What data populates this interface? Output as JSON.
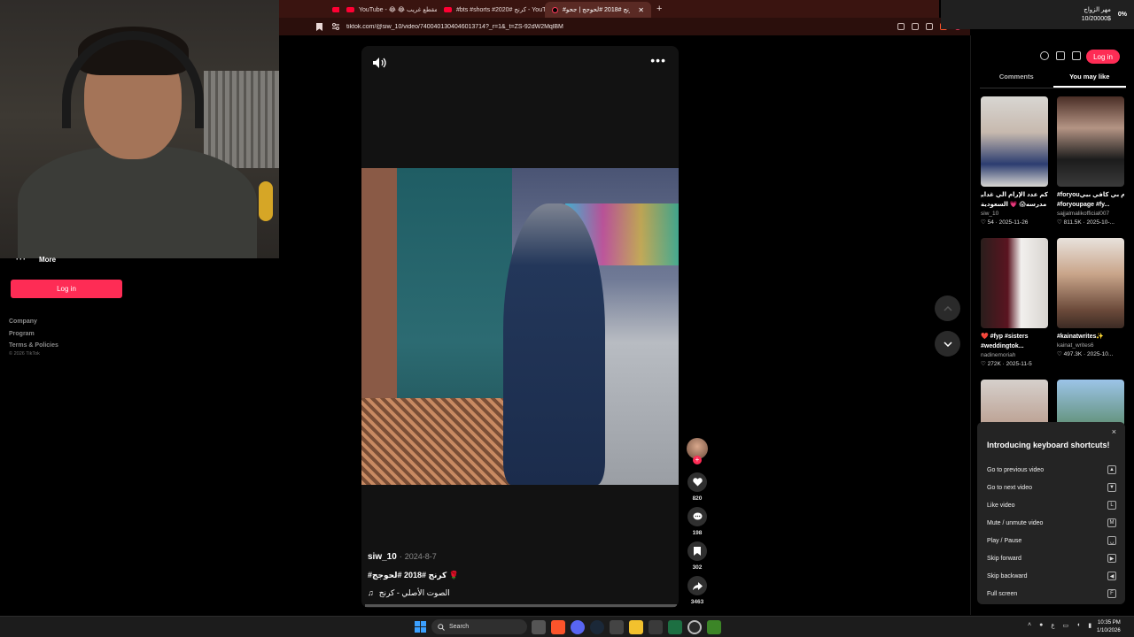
{
  "browser": {
    "tabs": [
      {
        "label": "",
        "icon": "youtube-icon",
        "active": false
      },
      {
        "label": "YouTube - 😂 😂 مقطع غريب",
        "icon": "youtube-icon",
        "active": false
      },
      {
        "label": "#bts #shorts #2020# كرنج - YouTube",
        "icon": "youtube-icon",
        "active": false
      },
      {
        "label": "#كرنج #2018 #لحوجج | جحو ...",
        "icon": "tiktok-icon",
        "active": true
      }
    ],
    "new_tab": "+",
    "url": "tiktok.com/@siw_10/video/7400401304046013714?_r=1&_t=ZS-92dW2MqlBM"
  },
  "notification": {
    "line1": "مهر الزواج",
    "line2": "10/20000$",
    "percent": "0%"
  },
  "sidebar": {
    "more_label": "More",
    "more_dots": "···",
    "login_label": "Log in",
    "links": [
      "Company",
      "Program",
      "Terms & Policies"
    ],
    "copyright": "© 2026 TikTok"
  },
  "video": {
    "author": "siw_10",
    "separator": "·",
    "date": "2024-8-7",
    "tags": "#كرنج #2018 #لحوجج 🌹",
    "music_icon": "♫",
    "music": "الصوت الأصلي - كرنج",
    "menu": "•••"
  },
  "actions": {
    "likes": "820",
    "comments": "198",
    "saves": "302",
    "shares": "3463"
  },
  "right_panel": {
    "login_label": "Log in",
    "tabs": [
      "Comments",
      "You may like"
    ],
    "active_tab": "You may like",
    "items": [
      {
        "title": "كم عدد الإرام الي غدايها في",
        "title2": "مدرسه😱 💗 السعودية",
        "user": "siw_10",
        "likes": "♡ 54",
        "date": "2025-11-26"
      },
      {
        "title": "#foryouلام بي كافي بيي",
        "title2": "#foryoupage #fy...",
        "user": "sajjalmalikofficial007",
        "likes": "♡ 811.5K",
        "date": "2025-10-..."
      },
      {
        "title": "❤️ #fyp #sisters",
        "title2": "#weddingtok...",
        "user": "nadinemoriah",
        "likes": "♡ 272K",
        "date": "2025-11-5"
      },
      {
        "title": "#kainatwrites✨",
        "title2": "",
        "user": "kainat_writes6",
        "likes": "♡ 497.3K",
        "date": "2025-10..."
      }
    ]
  },
  "keyboard_popup": {
    "close": "×",
    "title": "Introducing keyboard shortcuts!",
    "rows": [
      {
        "label": "Go to previous video",
        "key": "▲"
      },
      {
        "label": "Go to next video",
        "key": "▼"
      },
      {
        "label": "Like video",
        "key": "L"
      },
      {
        "label": "Mute / unmute video",
        "key": "M"
      },
      {
        "label": "Play / Pause",
        "key": "␣"
      },
      {
        "label": "Skip forward",
        "key": "▶"
      },
      {
        "label": "Skip backward",
        "key": "◀"
      },
      {
        "label": "Full screen",
        "key": "F"
      }
    ]
  },
  "taskbar": {
    "search_label": "Search",
    "time": "10:35 PM",
    "date": "1/10/2026"
  },
  "colors": {
    "brand": "#fe2c55",
    "tabbar": "#3a1410",
    "panel": "#242424"
  }
}
